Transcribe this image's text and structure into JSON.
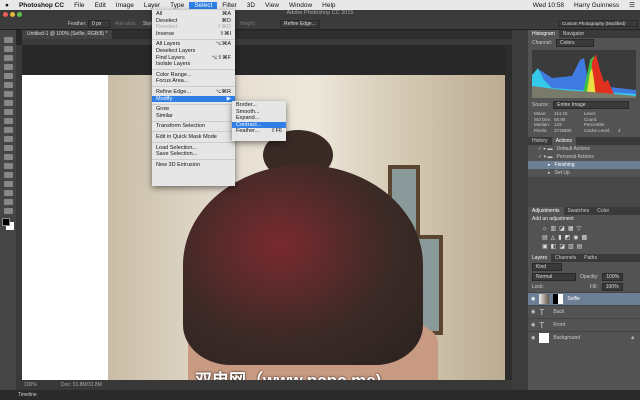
{
  "menubar": {
    "app": "Photoshop CC",
    "items": [
      "File",
      "Edit",
      "Image",
      "Layer",
      "Type",
      "Select",
      "Filter",
      "3D",
      "View",
      "Window",
      "Help"
    ],
    "clock": "Wed 10:58",
    "user": "Harry Guinness"
  },
  "window_title": "Adobe Photoshop CC 2015",
  "options": {
    "feather_label": "Feather:",
    "feather_value": "0 px",
    "antialias": "Anti-alias",
    "style": "Style:",
    "height": "Height:",
    "refine": "Refine Edge...",
    "workspace": "Custom Photography (Modified)"
  },
  "doc_tab": "Untitled-1 @ 100% (Selfie, RGB/8) *",
  "select_menu": [
    {
      "label": "All",
      "shortcut": "⌘A"
    },
    {
      "label": "Deselect",
      "shortcut": "⌘D"
    },
    {
      "label": "Reselect",
      "shortcut": "⇧⌘D",
      "disabled": true
    },
    {
      "label": "Inverse",
      "shortcut": "⇧⌘I"
    },
    {
      "sep": true
    },
    {
      "label": "All Layers",
      "shortcut": "⌥⌘A"
    },
    {
      "label": "Deselect Layers",
      "shortcut": ""
    },
    {
      "label": "Find Layers",
      "shortcut": "⌥⇧⌘F"
    },
    {
      "label": "Isolate Layers",
      "shortcut": ""
    },
    {
      "sep": true
    },
    {
      "label": "Color Range...",
      "shortcut": ""
    },
    {
      "label": "Focus Area...",
      "shortcut": ""
    },
    {
      "sep": true
    },
    {
      "label": "Refine Edge...",
      "shortcut": "⌥⌘R"
    },
    {
      "label": "Modify",
      "shortcut": "▶",
      "highlight": true
    },
    {
      "sep": true
    },
    {
      "label": "Grow",
      "shortcut": ""
    },
    {
      "label": "Similar",
      "shortcut": ""
    },
    {
      "sep": true
    },
    {
      "label": "Transform Selection",
      "shortcut": ""
    },
    {
      "sep": true
    },
    {
      "label": "Edit in Quick Mask Mode",
      "shortcut": ""
    },
    {
      "sep": true
    },
    {
      "label": "Load Selection...",
      "shortcut": ""
    },
    {
      "label": "Save Selection...",
      "shortcut": ""
    },
    {
      "sep": true
    },
    {
      "label": "New 3D Extrusion",
      "shortcut": ""
    }
  ],
  "modify_menu": [
    {
      "label": "Border...",
      "shortcut": ""
    },
    {
      "label": "Smooth...",
      "shortcut": ""
    },
    {
      "label": "Expand...",
      "shortcut": ""
    },
    {
      "label": "Contract...",
      "shortcut": "",
      "highlight": true
    },
    {
      "label": "Feather...",
      "shortcut": "⇧F6"
    }
  ],
  "histogram": {
    "tabs": [
      "Histogram",
      "Navigator"
    ],
    "channel_label": "Channel:",
    "channel": "Colors",
    "source_label": "Source:",
    "source": "Entire Image",
    "stats": [
      [
        "Mean:",
        "114.15",
        "Level:",
        ""
      ],
      [
        "Std Dev:",
        "68.90",
        "Count:",
        ""
      ],
      [
        "Median:",
        "123",
        "Percentile:",
        ""
      ],
      [
        "Pixels:",
        "2715800",
        "Cache Level:",
        "3"
      ]
    ]
  },
  "actions": {
    "tabs": [
      "History",
      "Actions"
    ],
    "items": [
      "Default Actions",
      "Personal Actions",
      "Finishing",
      "Set Up"
    ]
  },
  "adjustments": {
    "tabs": [
      "Adjustments",
      "Swatches",
      "Color"
    ],
    "title": "Add an adjustment"
  },
  "layers": {
    "tabs": [
      "Layers",
      "Channels",
      "Paths"
    ],
    "kind": "Kind",
    "blend": "Normal",
    "opacity_label": "Opacity:",
    "opacity": "100%",
    "lock_label": "Lock:",
    "fill_label": "Fill:",
    "fill": "100%",
    "items": [
      {
        "name": "Selfie",
        "type": "image",
        "selected": true
      },
      {
        "name": "Back",
        "type": "text"
      },
      {
        "name": "Front",
        "type": "text"
      },
      {
        "name": "Background",
        "type": "fill"
      }
    ]
  },
  "status": {
    "zoom": "100%",
    "doc": "Doc: 31.8M/31.8M"
  },
  "timeline": "Timeline",
  "watermark": "双电网（www.pcpc.me)"
}
